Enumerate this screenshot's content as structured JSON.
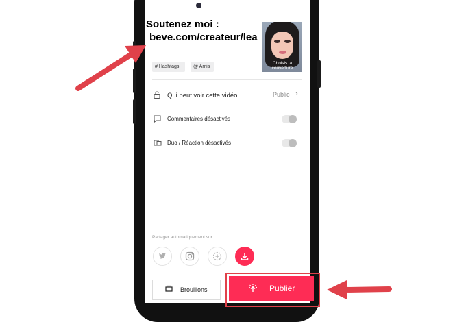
{
  "caption": {
    "line1": "Soutenez moi :",
    "line2": "beve.com/createur/lea"
  },
  "cover": {
    "label": "Choisis la couverture"
  },
  "tags": [
    {
      "icon": "#",
      "label": "Hashtags"
    },
    {
      "icon": "@",
      "label": "Amis"
    }
  ],
  "settings": {
    "privacy": {
      "label": "Qui peut voir cette vidéo",
      "value": "Public"
    },
    "comments": {
      "label": "Commentaires désactivés",
      "enabled": false
    },
    "duet": {
      "label": "Duo / Réaction désactivés",
      "enabled": false
    }
  },
  "share": {
    "label": "Partager automatiquement sur :"
  },
  "actions": {
    "drafts_label": "Brouillons",
    "publish_label": "Publier"
  },
  "colors": {
    "accent": "#fe2c55",
    "annotation_red": "#e0414a"
  }
}
